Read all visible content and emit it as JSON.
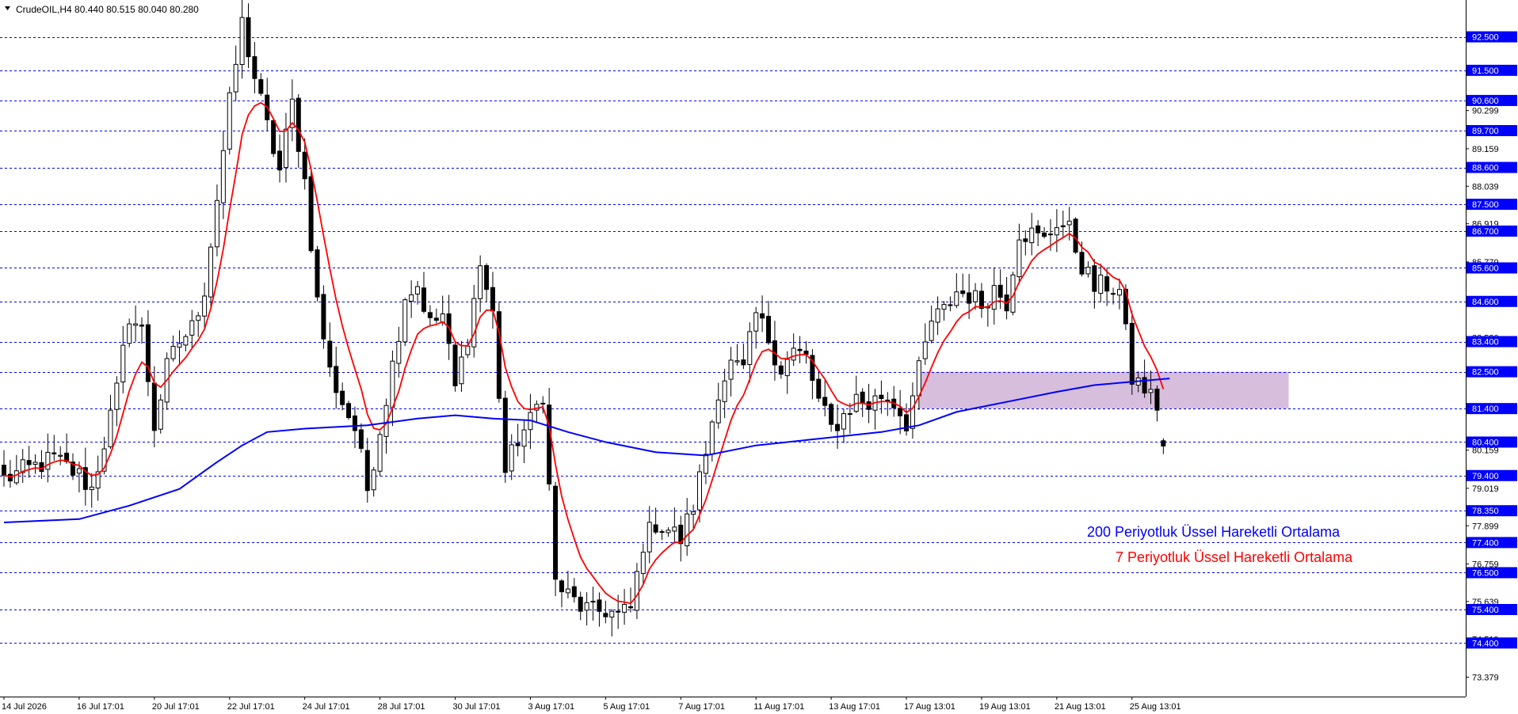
{
  "header": {
    "symbol_line": "CrudeOIL,H4  80.440 80.515 80.040 80.280"
  },
  "colors": {
    "background": "#ffffff",
    "grid_line": "#0000ff",
    "level_box": "#0000ff",
    "level_text": "#ffffff",
    "candle_bull": "#ffffff",
    "candle_bear": "#000000",
    "candle_outline": "#000000",
    "ema7": "#ff0000",
    "ema200": "#0000ff",
    "zone": "#c8a8d0"
  },
  "legend": {
    "ema200_label": "200 Periyotluk Üssel Hareketli Ortalama",
    "ema7_label": "7 Periyotluk Üssel Hareketli Ortalama"
  },
  "chart_data": {
    "type": "candlestick",
    "symbol": "CrudeOIL",
    "timeframe": "H4",
    "ohlc_last": {
      "open": 80.44,
      "high": 80.515,
      "low": 80.04,
      "close": 80.28
    },
    "y_range": [
      72.8,
      93.6
    ],
    "y_ticks": [
      "90.299",
      "89.159",
      "88.039",
      "86.919",
      "85.779",
      "83.520",
      "81.340",
      "80.159",
      "79.019",
      "77.899",
      "76.759",
      "75.639",
      "74.519",
      "73.379"
    ],
    "y_tick_values": [
      90.299,
      89.159,
      88.039,
      86.919,
      85.779,
      83.52,
      81.34,
      80.159,
      79.019,
      77.899,
      76.759,
      75.639,
      74.519,
      73.379
    ],
    "levels": [
      "92.500",
      "91.500",
      "90.600",
      "89.700",
      "88.600",
      "87.500",
      "86.700",
      "85.600",
      "84.600",
      "83.400",
      "82.500",
      "81.400",
      "80.400",
      "79.400",
      "78.350",
      "77.400",
      "76.500",
      "75.400",
      "74.400"
    ],
    "level_values": [
      92.5,
      91.5,
      90.6,
      89.7,
      88.6,
      87.5,
      86.7,
      85.6,
      84.6,
      83.4,
      82.5,
      81.4,
      80.4,
      79.4,
      78.35,
      77.4,
      76.5,
      75.4,
      74.4
    ],
    "x_labels": [
      "14 Jul 2026",
      "16 Jul 17:01",
      "20 Jul 17:01",
      "22 Jul 17:01",
      "24 Jul 17:01",
      "28 Jul 17:01",
      "30 Jul 17:01",
      "3 Aug 17:01",
      "5 Aug 17:01",
      "7 Aug 17:01",
      "11 Aug 17:01",
      "13 Aug 17:01",
      "17 Aug 13:01",
      "19 Aug 13:01",
      "21 Aug 13:01",
      "25 Aug 13:01"
    ],
    "x_label_index": [
      0,
      12,
      24,
      36,
      48,
      60,
      72,
      84,
      96,
      108,
      120,
      132,
      144,
      156,
      168,
      180
    ],
    "candle_count": 186,
    "path_points": [
      [
        0,
        79.3
      ],
      [
        4,
        79.6
      ],
      [
        8,
        79.9
      ],
      [
        12,
        79.4
      ],
      [
        14,
        79.0
      ],
      [
        16,
        80.4
      ],
      [
        18,
        81.9
      ],
      [
        20,
        84.2
      ],
      [
        22,
        83.7
      ],
      [
        24,
        80.9
      ],
      [
        26,
        82.6
      ],
      [
        28,
        83.4
      ],
      [
        30,
        83.8
      ],
      [
        32,
        85.0
      ],
      [
        34,
        87.7
      ],
      [
        36,
        90.5
      ],
      [
        38,
        92.9
      ],
      [
        40,
        91.3
      ],
      [
        42,
        89.8
      ],
      [
        44,
        88.5
      ],
      [
        46,
        90.5
      ],
      [
        48,
        88.2
      ],
      [
        50,
        84.6
      ],
      [
        52,
        82.5
      ],
      [
        54,
        81.6
      ],
      [
        56,
        80.8
      ],
      [
        58,
        79.0
      ],
      [
        60,
        80.8
      ],
      [
        62,
        82.7
      ],
      [
        64,
        84.8
      ],
      [
        66,
        85.1
      ],
      [
        68,
        83.9
      ],
      [
        70,
        84.2
      ],
      [
        72,
        82.0
      ],
      [
        74,
        83.6
      ],
      [
        76,
        85.7
      ],
      [
        78,
        84.2
      ],
      [
        80,
        79.5
      ],
      [
        82,
        80.5
      ],
      [
        84,
        81.0
      ],
      [
        86,
        81.9
      ],
      [
        88,
        76.2
      ],
      [
        90,
        75.8
      ],
      [
        92,
        75.5
      ],
      [
        94,
        75.3
      ],
      [
        96,
        75.4
      ],
      [
        98,
        75.2
      ],
      [
        100,
        75.4
      ],
      [
        102,
        77.4
      ],
      [
        104,
        78.0
      ],
      [
        106,
        77.8
      ],
      [
        108,
        77.5
      ],
      [
        110,
        78.5
      ],
      [
        112,
        80.1
      ],
      [
        114,
        82.0
      ],
      [
        116,
        82.7
      ],
      [
        118,
        82.5
      ],
      [
        120,
        84.2
      ],
      [
        122,
        83.5
      ],
      [
        124,
        82.6
      ],
      [
        126,
        83.1
      ],
      [
        128,
        82.9
      ],
      [
        130,
        81.6
      ],
      [
        132,
        80.8
      ],
      [
        134,
        81.2
      ],
      [
        136,
        81.7
      ],
      [
        138,
        81.5
      ],
      [
        140,
        81.8
      ],
      [
        142,
        81.6
      ],
      [
        144,
        81.0
      ],
      [
        146,
        82.5
      ],
      [
        148,
        84.0
      ],
      [
        150,
        84.3
      ],
      [
        152,
        84.9
      ],
      [
        154,
        84.8
      ],
      [
        156,
        84.5
      ],
      [
        158,
        85.0
      ],
      [
        160,
        84.6
      ],
      [
        162,
        86.7
      ],
      [
        164,
        86.6
      ],
      [
        166,
        86.4
      ],
      [
        168,
        87.0
      ],
      [
        170,
        86.7
      ],
      [
        172,
        85.7
      ],
      [
        174,
        85.0
      ],
      [
        176,
        85.1
      ],
      [
        178,
        84.9
      ],
      [
        180,
        82.3
      ],
      [
        182,
        82.0
      ],
      [
        184,
        81.5
      ],
      [
        185,
        80.4
      ]
    ],
    "ema200_points": [
      [
        0,
        78.0
      ],
      [
        12,
        78.1
      ],
      [
        20,
        78.5
      ],
      [
        28,
        79.0
      ],
      [
        34,
        79.8
      ],
      [
        38,
        80.3
      ],
      [
        42,
        80.7
      ],
      [
        48,
        80.8
      ],
      [
        58,
        80.9
      ],
      [
        66,
        81.1
      ],
      [
        72,
        81.2
      ],
      [
        78,
        81.1
      ],
      [
        84,
        81.05
      ],
      [
        90,
        80.7
      ],
      [
        96,
        80.4
      ],
      [
        104,
        80.1
      ],
      [
        112,
        80.0
      ],
      [
        120,
        80.3
      ],
      [
        130,
        80.5
      ],
      [
        140,
        80.7
      ],
      [
        146,
        80.9
      ],
      [
        152,
        81.3
      ],
      [
        160,
        81.6
      ],
      [
        168,
        81.9
      ],
      [
        174,
        82.1
      ],
      [
        180,
        82.2
      ],
      [
        186,
        82.3
      ]
    ],
    "zone": {
      "from_index": 146,
      "to_index": 205,
      "low": 81.4,
      "high": 82.5
    }
  }
}
